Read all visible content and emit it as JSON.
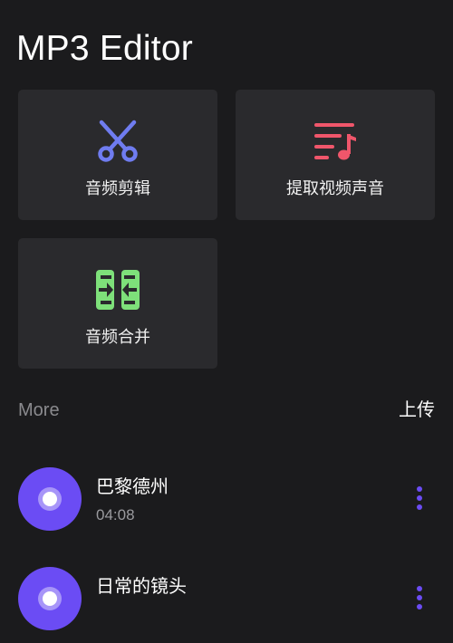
{
  "app": {
    "title": "MP3 Editor"
  },
  "tools": {
    "cut": {
      "label": "音频剪辑",
      "icon": "scissors-icon",
      "color": "#6f7cf0"
    },
    "extract": {
      "label": "提取视频声音",
      "icon": "music-list-icon",
      "color": "#f0566b"
    },
    "merge": {
      "label": "音频合并",
      "icon": "merge-icon",
      "color": "#7ee07a"
    }
  },
  "more": {
    "label": "More",
    "upload_label": "上传"
  },
  "songs": [
    {
      "title": "巴黎德州",
      "duration": "04:08"
    },
    {
      "title": "日常的镜头",
      "duration": ""
    }
  ],
  "colors": {
    "background": "#1b1b1d",
    "card": "#2a2a2d",
    "accent": "#6b4cf4"
  }
}
